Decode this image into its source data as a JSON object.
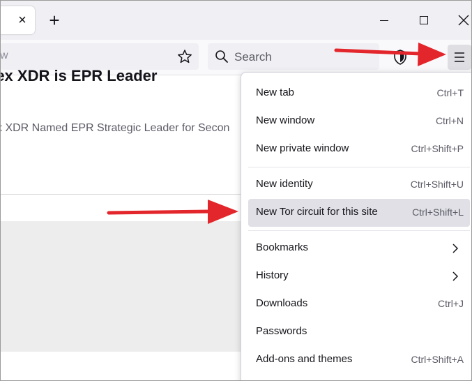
{
  "tabstrip": {
    "tab_close_glyph": "×",
    "new_tab_glyph": "+",
    "window_controls": [
      "minimize-icon",
      "maximize-icon",
      "close-icon"
    ]
  },
  "navbar": {
    "url_fragment": "w",
    "search_placeholder": "Search",
    "icons": [
      "star-icon",
      "search-icon",
      "shield-icon",
      "hamburger-menu-icon"
    ]
  },
  "page": {
    "headline": "tex XDR is EPR Leader",
    "subline": "x XDR Named EPR Strategic Leader for Secon"
  },
  "menu": {
    "items": [
      {
        "label": "New tab",
        "shortcut": "Ctrl+T"
      },
      {
        "label": "New window",
        "shortcut": "Ctrl+N"
      },
      {
        "label": "New private window",
        "shortcut": "Ctrl+Shift+P"
      },
      {
        "label": "New identity",
        "shortcut": "Ctrl+Shift+U"
      },
      {
        "label": "New Tor circuit for this site",
        "shortcut": "Ctrl+Shift+L"
      },
      {
        "label": "Bookmarks",
        "shortcut": ""
      },
      {
        "label": "History",
        "shortcut": ""
      },
      {
        "label": "Downloads",
        "shortcut": "Ctrl+J"
      },
      {
        "label": "Passwords",
        "shortcut": ""
      },
      {
        "label": "Add-ons and themes",
        "shortcut": "Ctrl+Shift+A"
      }
    ],
    "highlighted": "New Tor circuit for this site"
  },
  "colors": {
    "annotation_arrow": "#e3262b",
    "highlight": "#e0e0e6",
    "toolbar": "#f9f9fb",
    "tabstrip": "#f0f0f4"
  }
}
